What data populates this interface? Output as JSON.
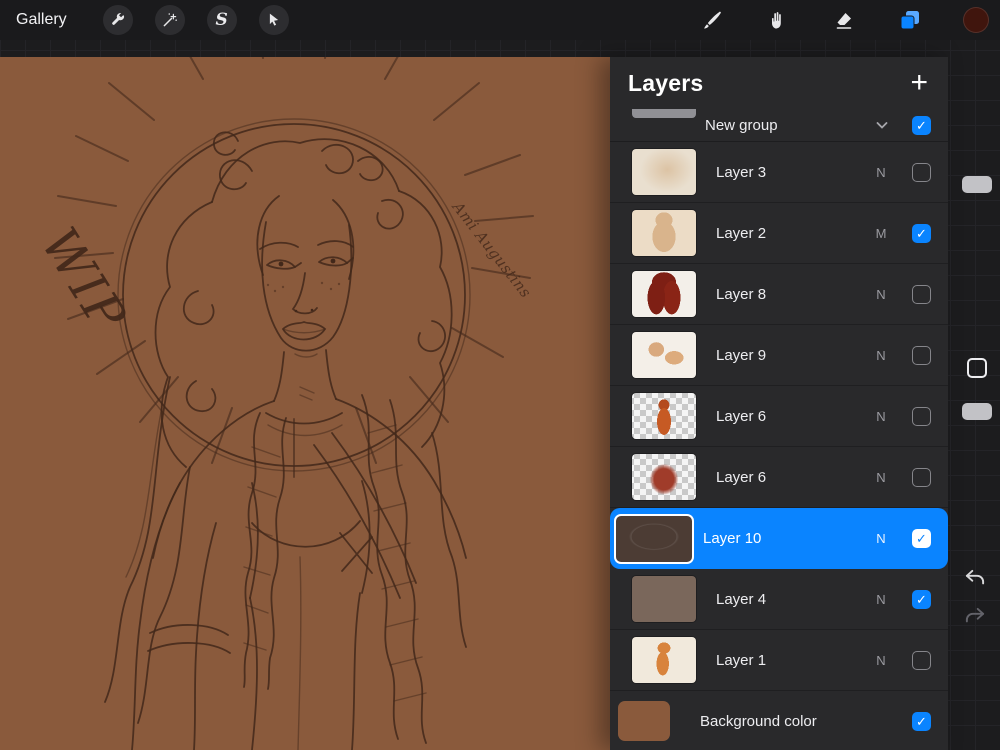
{
  "topbar": {
    "gallery_label": "Gallery",
    "selection_glyph": "S"
  },
  "layers_panel": {
    "title": "Layers",
    "add_glyph": "+",
    "group": {
      "label": "New group",
      "checked": true
    },
    "rows": [
      {
        "name": "Layer 3",
        "blend": "N",
        "checked": false,
        "thumb": "cream"
      },
      {
        "name": "Layer 2",
        "blend": "M",
        "checked": true,
        "thumb": "cream-figure"
      },
      {
        "name": "Layer 8",
        "blend": "N",
        "checked": false,
        "thumb": "red-hair"
      },
      {
        "name": "Layer 9",
        "blend": "N",
        "checked": false,
        "thumb": "skin"
      },
      {
        "name": "Layer 6",
        "blend": "N",
        "checked": false,
        "thumb": "checker-figure"
      },
      {
        "name": "Layer 6",
        "blend": "N",
        "checked": false,
        "thumb": "checker-blob"
      },
      {
        "name": "Layer 10",
        "blend": "N",
        "checked": true,
        "selected": true,
        "thumb": "dark-sketch"
      },
      {
        "name": "Layer 4",
        "blend": "N",
        "checked": true,
        "thumb": "brown"
      },
      {
        "name": "Layer 1",
        "blend": "N",
        "checked": false,
        "thumb": "orange-figure"
      },
      {
        "name": "Background color",
        "blend": "",
        "checked": true,
        "thumb": "bg-brown",
        "background_row": true
      }
    ]
  },
  "canvas": {
    "wip_text": "WIP",
    "signature": "Ami Augustins"
  },
  "icons": {
    "check": "✓"
  },
  "colors": {
    "accent": "#0a84ff",
    "canvas": "#8a5a3c",
    "ink": "#42281a",
    "color_swatch": "#40150d"
  }
}
